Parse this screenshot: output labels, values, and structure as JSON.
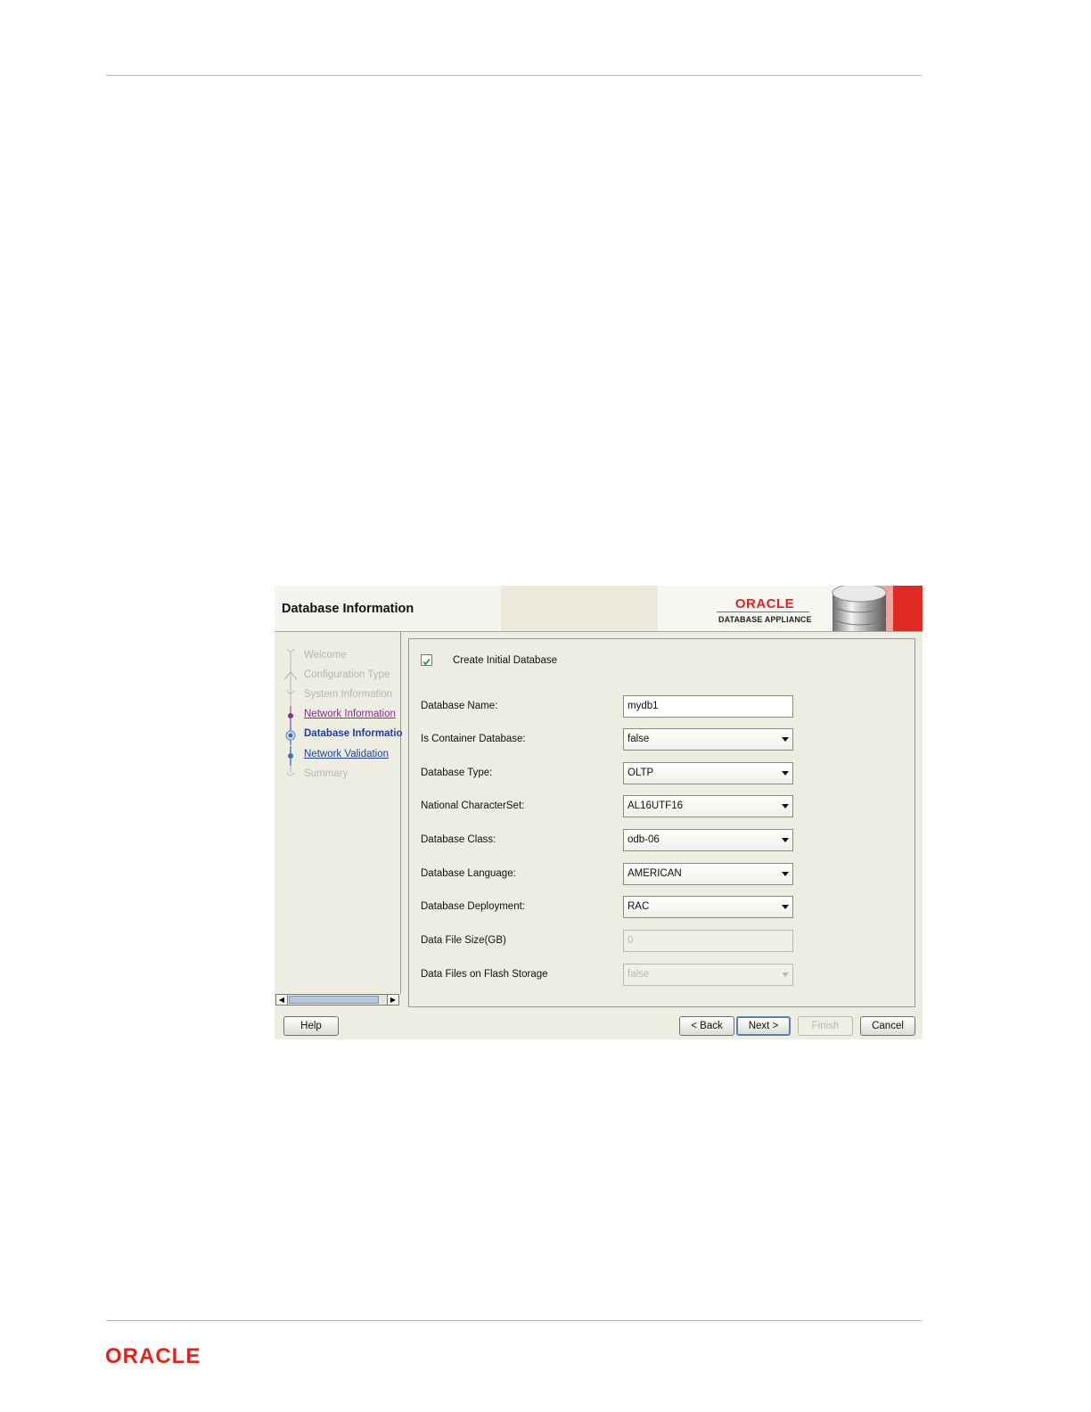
{
  "footer_logo_text": "ORACLE",
  "dialog": {
    "title": "Database Information",
    "brand_word": "ORACLE",
    "brand_sub": "DATABASE APPLIANCE",
    "brand_color": "#e2231a"
  },
  "nav": {
    "items": [
      {
        "label": "Welcome",
        "state": "dim"
      },
      {
        "label": "Configuration Type",
        "state": "dim"
      },
      {
        "label": "System Information",
        "state": "dim"
      },
      {
        "label": "Network Information",
        "state": "visited"
      },
      {
        "label": "Database Informatio",
        "state": "current"
      },
      {
        "label": "Network Validation",
        "state": "link"
      },
      {
        "label": "Summary",
        "state": "dim"
      }
    ]
  },
  "form": {
    "create_initial_db": {
      "label": "Create Initial Database",
      "checked": true
    },
    "fields": [
      {
        "label": "Database Name:",
        "value": "mydb1",
        "kind": "text"
      },
      {
        "label": "Is Container Database:",
        "value": "false",
        "kind": "select"
      },
      {
        "label": "Database Type:",
        "value": "OLTP",
        "kind": "select"
      },
      {
        "label": "National CharacterSet:",
        "value": "AL16UTF16",
        "kind": "select"
      },
      {
        "label": "Database Class:",
        "value": "odb-06",
        "kind": "select"
      },
      {
        "label": "Database Language:",
        "value": "AMERICAN",
        "kind": "select"
      },
      {
        "label": "Database Deployment:",
        "value": "RAC",
        "kind": "select"
      },
      {
        "label": "Data File Size(GB)",
        "value": "0",
        "kind": "text-disabled"
      },
      {
        "label": "Data Files on Flash Storage",
        "value": "false",
        "kind": "select-disabled"
      }
    ]
  },
  "buttons": {
    "help": "Help",
    "back": "< Back",
    "next": "Next >",
    "finish": "Finish",
    "cancel": "Cancel"
  }
}
